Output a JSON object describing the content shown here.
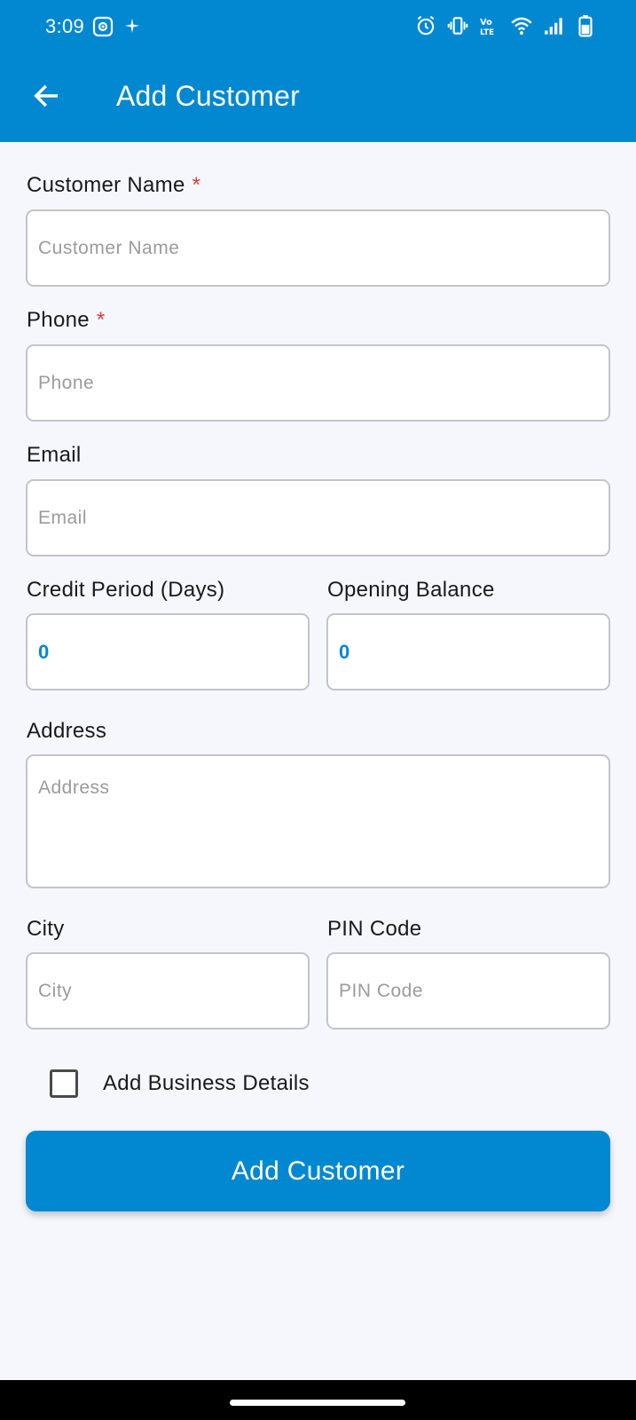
{
  "status_bar": {
    "time": "3:09",
    "icons": [
      "screenshot-icon",
      "sparkle-icon",
      "alarm-icon",
      "vibrate-icon",
      "volte-icon",
      "wifi-icon",
      "signal-icon",
      "battery-icon"
    ]
  },
  "app_bar": {
    "title": "Add Customer",
    "back_icon": "arrow-left-icon"
  },
  "form": {
    "customer_name": {
      "label": "Customer Name",
      "required_mark": "*",
      "placeholder": "Customer Name",
      "value": ""
    },
    "phone": {
      "label": "Phone",
      "required_mark": "*",
      "placeholder": "Phone",
      "value": ""
    },
    "email": {
      "label": "Email",
      "placeholder": "Email",
      "value": ""
    },
    "credit_period": {
      "label": "Credit Period (Days)",
      "value": "0"
    },
    "opening_balance": {
      "label": "Opening Balance",
      "value": "0"
    },
    "address": {
      "label": "Address",
      "placeholder": "Address",
      "value": ""
    },
    "city": {
      "label": "City",
      "placeholder": "City",
      "value": ""
    },
    "pin_code": {
      "label": "PIN Code",
      "placeholder": "PIN Code",
      "value": ""
    },
    "business_details": {
      "label": "Add Business Details",
      "checked": false
    },
    "submit_label": "Add Customer"
  },
  "colors": {
    "primary": "#0288d1",
    "background": "#f5f7fc",
    "required": "#e53935",
    "input_border": "#c4c4c8"
  }
}
